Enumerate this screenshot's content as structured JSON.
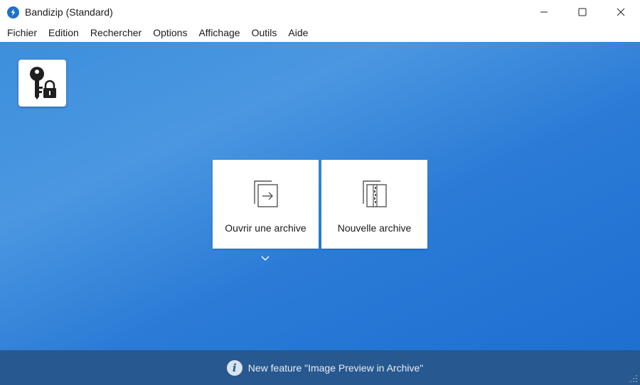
{
  "window": {
    "title": "Bandizip (Standard)"
  },
  "menu": [
    "Fichier",
    "Edition",
    "Rechercher",
    "Options",
    "Affichage",
    "Outils",
    "Aide"
  ],
  "actions": {
    "open_label": "Ouvrir une archive",
    "new_label": "Nouvelle archive"
  },
  "status": {
    "text": "New feature \"Image Preview in Archive\"",
    "info_glyph": "i"
  },
  "colors": {
    "accent": "#1d72c8",
    "background_top": "#4b97e1",
    "background_bottom": "#1f6fd2",
    "statusbar": "#27588f"
  },
  "icons": {
    "app": "bandizip-logo-icon",
    "key_lock": "key-lock-icon",
    "open": "open-archive-icon",
    "new": "new-archive-icon",
    "info": "info-icon",
    "chevron": "chevron-down-icon"
  }
}
